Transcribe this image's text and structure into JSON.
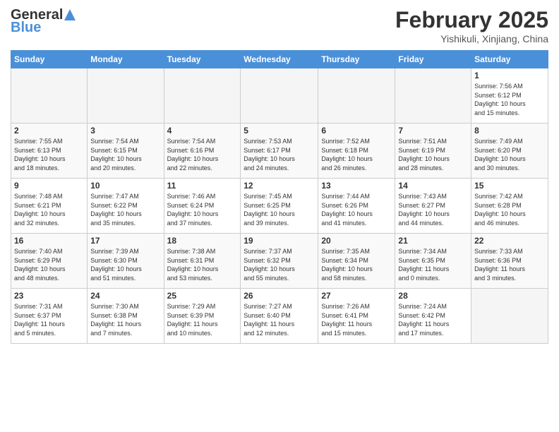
{
  "header": {
    "logo_line1": "General",
    "logo_line2": "Blue",
    "title": "February 2025",
    "location": "Yishikuli, Xinjiang, China"
  },
  "weekdays": [
    "Sunday",
    "Monday",
    "Tuesday",
    "Wednesday",
    "Thursday",
    "Friday",
    "Saturday"
  ],
  "weeks": [
    [
      {
        "day": "",
        "info": ""
      },
      {
        "day": "",
        "info": ""
      },
      {
        "day": "",
        "info": ""
      },
      {
        "day": "",
        "info": ""
      },
      {
        "day": "",
        "info": ""
      },
      {
        "day": "",
        "info": ""
      },
      {
        "day": "1",
        "info": "Sunrise: 7:56 AM\nSunset: 6:12 PM\nDaylight: 10 hours\nand 15 minutes."
      }
    ],
    [
      {
        "day": "2",
        "info": "Sunrise: 7:55 AM\nSunset: 6:13 PM\nDaylight: 10 hours\nand 18 minutes."
      },
      {
        "day": "3",
        "info": "Sunrise: 7:54 AM\nSunset: 6:15 PM\nDaylight: 10 hours\nand 20 minutes."
      },
      {
        "day": "4",
        "info": "Sunrise: 7:54 AM\nSunset: 6:16 PM\nDaylight: 10 hours\nand 22 minutes."
      },
      {
        "day": "5",
        "info": "Sunrise: 7:53 AM\nSunset: 6:17 PM\nDaylight: 10 hours\nand 24 minutes."
      },
      {
        "day": "6",
        "info": "Sunrise: 7:52 AM\nSunset: 6:18 PM\nDaylight: 10 hours\nand 26 minutes."
      },
      {
        "day": "7",
        "info": "Sunrise: 7:51 AM\nSunset: 6:19 PM\nDaylight: 10 hours\nand 28 minutes."
      },
      {
        "day": "8",
        "info": "Sunrise: 7:49 AM\nSunset: 6:20 PM\nDaylight: 10 hours\nand 30 minutes."
      }
    ],
    [
      {
        "day": "9",
        "info": "Sunrise: 7:48 AM\nSunset: 6:21 PM\nDaylight: 10 hours\nand 32 minutes."
      },
      {
        "day": "10",
        "info": "Sunrise: 7:47 AM\nSunset: 6:22 PM\nDaylight: 10 hours\nand 35 minutes."
      },
      {
        "day": "11",
        "info": "Sunrise: 7:46 AM\nSunset: 6:24 PM\nDaylight: 10 hours\nand 37 minutes."
      },
      {
        "day": "12",
        "info": "Sunrise: 7:45 AM\nSunset: 6:25 PM\nDaylight: 10 hours\nand 39 minutes."
      },
      {
        "day": "13",
        "info": "Sunrise: 7:44 AM\nSunset: 6:26 PM\nDaylight: 10 hours\nand 41 minutes."
      },
      {
        "day": "14",
        "info": "Sunrise: 7:43 AM\nSunset: 6:27 PM\nDaylight: 10 hours\nand 44 minutes."
      },
      {
        "day": "15",
        "info": "Sunrise: 7:42 AM\nSunset: 6:28 PM\nDaylight: 10 hours\nand 46 minutes."
      }
    ],
    [
      {
        "day": "16",
        "info": "Sunrise: 7:40 AM\nSunset: 6:29 PM\nDaylight: 10 hours\nand 48 minutes."
      },
      {
        "day": "17",
        "info": "Sunrise: 7:39 AM\nSunset: 6:30 PM\nDaylight: 10 hours\nand 51 minutes."
      },
      {
        "day": "18",
        "info": "Sunrise: 7:38 AM\nSunset: 6:31 PM\nDaylight: 10 hours\nand 53 minutes."
      },
      {
        "day": "19",
        "info": "Sunrise: 7:37 AM\nSunset: 6:32 PM\nDaylight: 10 hours\nand 55 minutes."
      },
      {
        "day": "20",
        "info": "Sunrise: 7:35 AM\nSunset: 6:34 PM\nDaylight: 10 hours\nand 58 minutes."
      },
      {
        "day": "21",
        "info": "Sunrise: 7:34 AM\nSunset: 6:35 PM\nDaylight: 11 hours\nand 0 minutes."
      },
      {
        "day": "22",
        "info": "Sunrise: 7:33 AM\nSunset: 6:36 PM\nDaylight: 11 hours\nand 3 minutes."
      }
    ],
    [
      {
        "day": "23",
        "info": "Sunrise: 7:31 AM\nSunset: 6:37 PM\nDaylight: 11 hours\nand 5 minutes."
      },
      {
        "day": "24",
        "info": "Sunrise: 7:30 AM\nSunset: 6:38 PM\nDaylight: 11 hours\nand 7 minutes."
      },
      {
        "day": "25",
        "info": "Sunrise: 7:29 AM\nSunset: 6:39 PM\nDaylight: 11 hours\nand 10 minutes."
      },
      {
        "day": "26",
        "info": "Sunrise: 7:27 AM\nSunset: 6:40 PM\nDaylight: 11 hours\nand 12 minutes."
      },
      {
        "day": "27",
        "info": "Sunrise: 7:26 AM\nSunset: 6:41 PM\nDaylight: 11 hours\nand 15 minutes."
      },
      {
        "day": "28",
        "info": "Sunrise: 7:24 AM\nSunset: 6:42 PM\nDaylight: 11 hours\nand 17 minutes."
      },
      {
        "day": "",
        "info": ""
      }
    ]
  ]
}
